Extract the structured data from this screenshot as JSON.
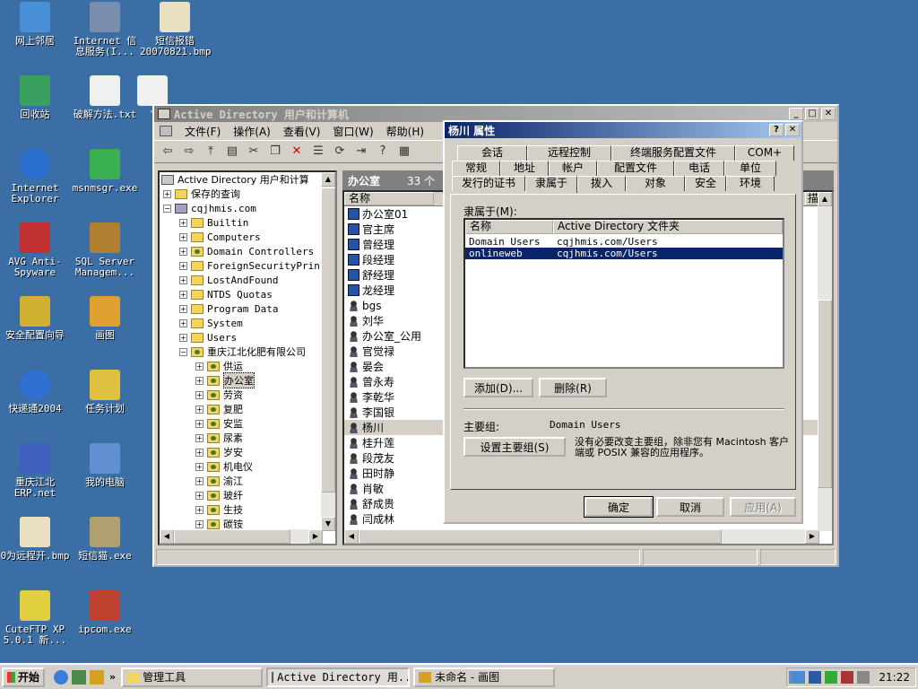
{
  "desktop_icons": [
    {
      "label": "网上邻居",
      "icon": "network-icon"
    },
    {
      "label": "Internet 信息服务(I...",
      "icon": "iis-icon"
    },
    {
      "label": "短信报错 20070821.bmp",
      "icon": "bmp-file-icon"
    },
    {
      "label": "回收站",
      "icon": "recycle-bin-icon"
    },
    {
      "label": "破解方法.txt",
      "icon": "txt-file-icon"
    },
    {
      "label": "\"",
      "icon": "txt-file-icon"
    },
    {
      "label": "Internet Explorer",
      "icon": "ie-icon"
    },
    {
      "label": "msnmsgr.exe",
      "icon": "msn-icon"
    },
    {
      "label": "AVG Anti-Spyware",
      "icon": "avg-icon"
    },
    {
      "label": "SQL Server Managem...",
      "icon": "sql-server-icon"
    },
    {
      "label": "安全配置向导",
      "icon": "security-wizard-icon"
    },
    {
      "label": "画图",
      "icon": "paint-icon"
    },
    {
      "label": "快递通2004",
      "icon": "express-icon"
    },
    {
      "label": "任务计划",
      "icon": "scheduled-tasks-icon"
    },
    {
      "label": "重庆江北 ERP.net",
      "icon": "erp-icon"
    },
    {
      "label": "我的电脑",
      "icon": "my-computer-icon"
    },
    {
      "label": "0为远程开.bmp",
      "icon": "bmp-file-icon"
    },
    {
      "label": "短信猫.exe",
      "icon": "sms-modem-icon"
    },
    {
      "label": "CuteFTP XP 5.0.1 新...",
      "icon": "cuteftp-icon"
    },
    {
      "label": "ipcom.exe",
      "icon": "ipcom-icon"
    }
  ],
  "ad_window": {
    "title": "Active Directory 用户和计算机",
    "menu": [
      "文件(F)",
      "操作(A)",
      "查看(V)",
      "窗口(W)",
      "帮助(H)"
    ],
    "tree_root": "Active Directory 用户和计算",
    "tree": [
      {
        "label": "保存的查询",
        "level": 1,
        "kind": "folder"
      },
      {
        "label": "cqjhmis.com",
        "level": 1,
        "kind": "domain"
      },
      {
        "label": "Builtin",
        "level": 2,
        "kind": "folder"
      },
      {
        "label": "Computers",
        "level": 2,
        "kind": "folder"
      },
      {
        "label": "Domain Controllers",
        "level": 2,
        "kind": "ou"
      },
      {
        "label": "ForeignSecurityPrinci",
        "level": 2,
        "kind": "folder"
      },
      {
        "label": "LostAndFound",
        "level": 2,
        "kind": "folder"
      },
      {
        "label": "NTDS Quotas",
        "level": 2,
        "kind": "folder"
      },
      {
        "label": "Program Data",
        "level": 2,
        "kind": "folder"
      },
      {
        "label": "System",
        "level": 2,
        "kind": "folder"
      },
      {
        "label": "Users",
        "level": 2,
        "kind": "folder"
      },
      {
        "label": "重庆江北化肥有限公司",
        "level": 2,
        "kind": "ou"
      },
      {
        "label": "供运",
        "level": 3,
        "kind": "ou"
      },
      {
        "label": "办公室",
        "level": 3,
        "kind": "ou"
      },
      {
        "label": "劳资",
        "level": 3,
        "kind": "ou"
      },
      {
        "label": "复肥",
        "level": 3,
        "kind": "ou"
      },
      {
        "label": "安监",
        "level": 3,
        "kind": "ou"
      },
      {
        "label": "尿素",
        "level": 3,
        "kind": "ou"
      },
      {
        "label": "岁安",
        "level": 3,
        "kind": "ou"
      },
      {
        "label": "机电仪",
        "level": 3,
        "kind": "ou"
      },
      {
        "label": "渝江",
        "level": 3,
        "kind": "ou"
      },
      {
        "label": "玻纤",
        "level": 3,
        "kind": "ou"
      },
      {
        "label": "生技",
        "level": 3,
        "kind": "ou"
      },
      {
        "label": "碳铵",
        "level": 3,
        "kind": "ou"
      }
    ],
    "list_header": "办公室",
    "list_count": "33 个",
    "column_name": "名称",
    "column_desc": "描述",
    "list_items": [
      {
        "name": "办公室01",
        "kind": "pc"
      },
      {
        "name": "官主席",
        "kind": "pc"
      },
      {
        "name": "曾经理",
        "kind": "pc"
      },
      {
        "name": "段经理",
        "kind": "pc"
      },
      {
        "name": "舒经理",
        "kind": "pc"
      },
      {
        "name": "龙经理",
        "kind": "pc"
      },
      {
        "name": "bgs",
        "kind": "user"
      },
      {
        "name": "刘华",
        "kind": "user"
      },
      {
        "name": "办公室_公用",
        "kind": "user"
      },
      {
        "name": "官觉禄",
        "kind": "user"
      },
      {
        "name": "晏会",
        "kind": "user"
      },
      {
        "name": "曾永寿",
        "kind": "user"
      },
      {
        "name": "李乾华",
        "kind": "user"
      },
      {
        "name": "李国银",
        "kind": "user"
      },
      {
        "name": "杨川",
        "kind": "user"
      },
      {
        "name": "桂升莲",
        "kind": "user"
      },
      {
        "name": "段茂友",
        "kind": "user"
      },
      {
        "name": "田时静",
        "kind": "user"
      },
      {
        "name": "肖敏",
        "kind": "user"
      },
      {
        "name": "舒成贵",
        "kind": "user"
      },
      {
        "name": "闫成林",
        "kind": "user"
      }
    ]
  },
  "dialog": {
    "title": "杨川 属性",
    "tabs_row1": [
      "会话",
      "远程控制",
      "终端服务配置文件",
      "COM+"
    ],
    "tabs_row2": [
      "常规",
      "地址",
      "帐户",
      "配置文件",
      "电话",
      "单位"
    ],
    "tabs_row3": [
      "发行的证书",
      "隶属于",
      "拨入",
      "对象",
      "安全",
      "环境"
    ],
    "memberof_label": "隶属于(M):",
    "col_name": "名称",
    "col_folder": "Active Directory 文件夹",
    "rows": [
      {
        "name": "Domain Users",
        "folder": "cqjhmis.com/Users"
      },
      {
        "name": "onlineweb",
        "folder": "cqjhmis.com/Users"
      }
    ],
    "add_button": "添加(D)...",
    "remove_button": "删除(R)",
    "primary_group_label": "主要组:",
    "primary_group_value": "Domain Users",
    "set_primary_button": "设置主要组(S)",
    "note": "没有必要改变主要组，除非您有 Macintosh 客户端或 POSIX 兼容的应用程序。",
    "ok": "确定",
    "cancel": "取消",
    "apply": "应用(A)"
  },
  "taskbar": {
    "start": "开始",
    "tasks": [
      "管理工具",
      "Active Directory 用...",
      "未命名 - 画图"
    ],
    "clock": "21:22"
  }
}
